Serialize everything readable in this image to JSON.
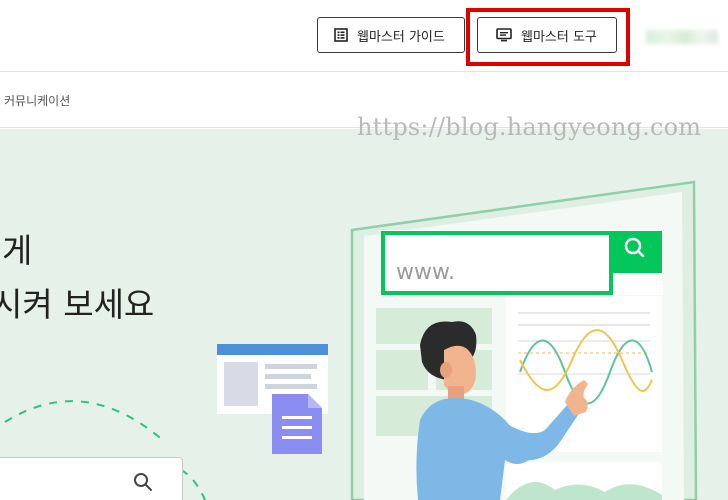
{
  "header": {
    "guide_button": {
      "label": "웹마스터 가이드",
      "icon": "document-list-icon"
    },
    "tools_button": {
      "label": "웹마스터 도구",
      "icon": "monitor-icon"
    },
    "highlight_color": "#e00000"
  },
  "subnav": {
    "items": [
      {
        "label": "커뮤니케이션"
      }
    ]
  },
  "watermark": "https://blog.hangyeong.com",
  "hero": {
    "line1": "게",
    "line2": "시켜 보세요",
    "illustration": {
      "url_text": "www.",
      "search_icon": "search-icon"
    },
    "search": {
      "icon": "search-icon"
    }
  },
  "colors": {
    "brand_green": "#03c75a",
    "hero_bg": "#e6f1e9",
    "accent_blue": "#4d8fd8",
    "doc_purple": "#8b8ef0"
  }
}
